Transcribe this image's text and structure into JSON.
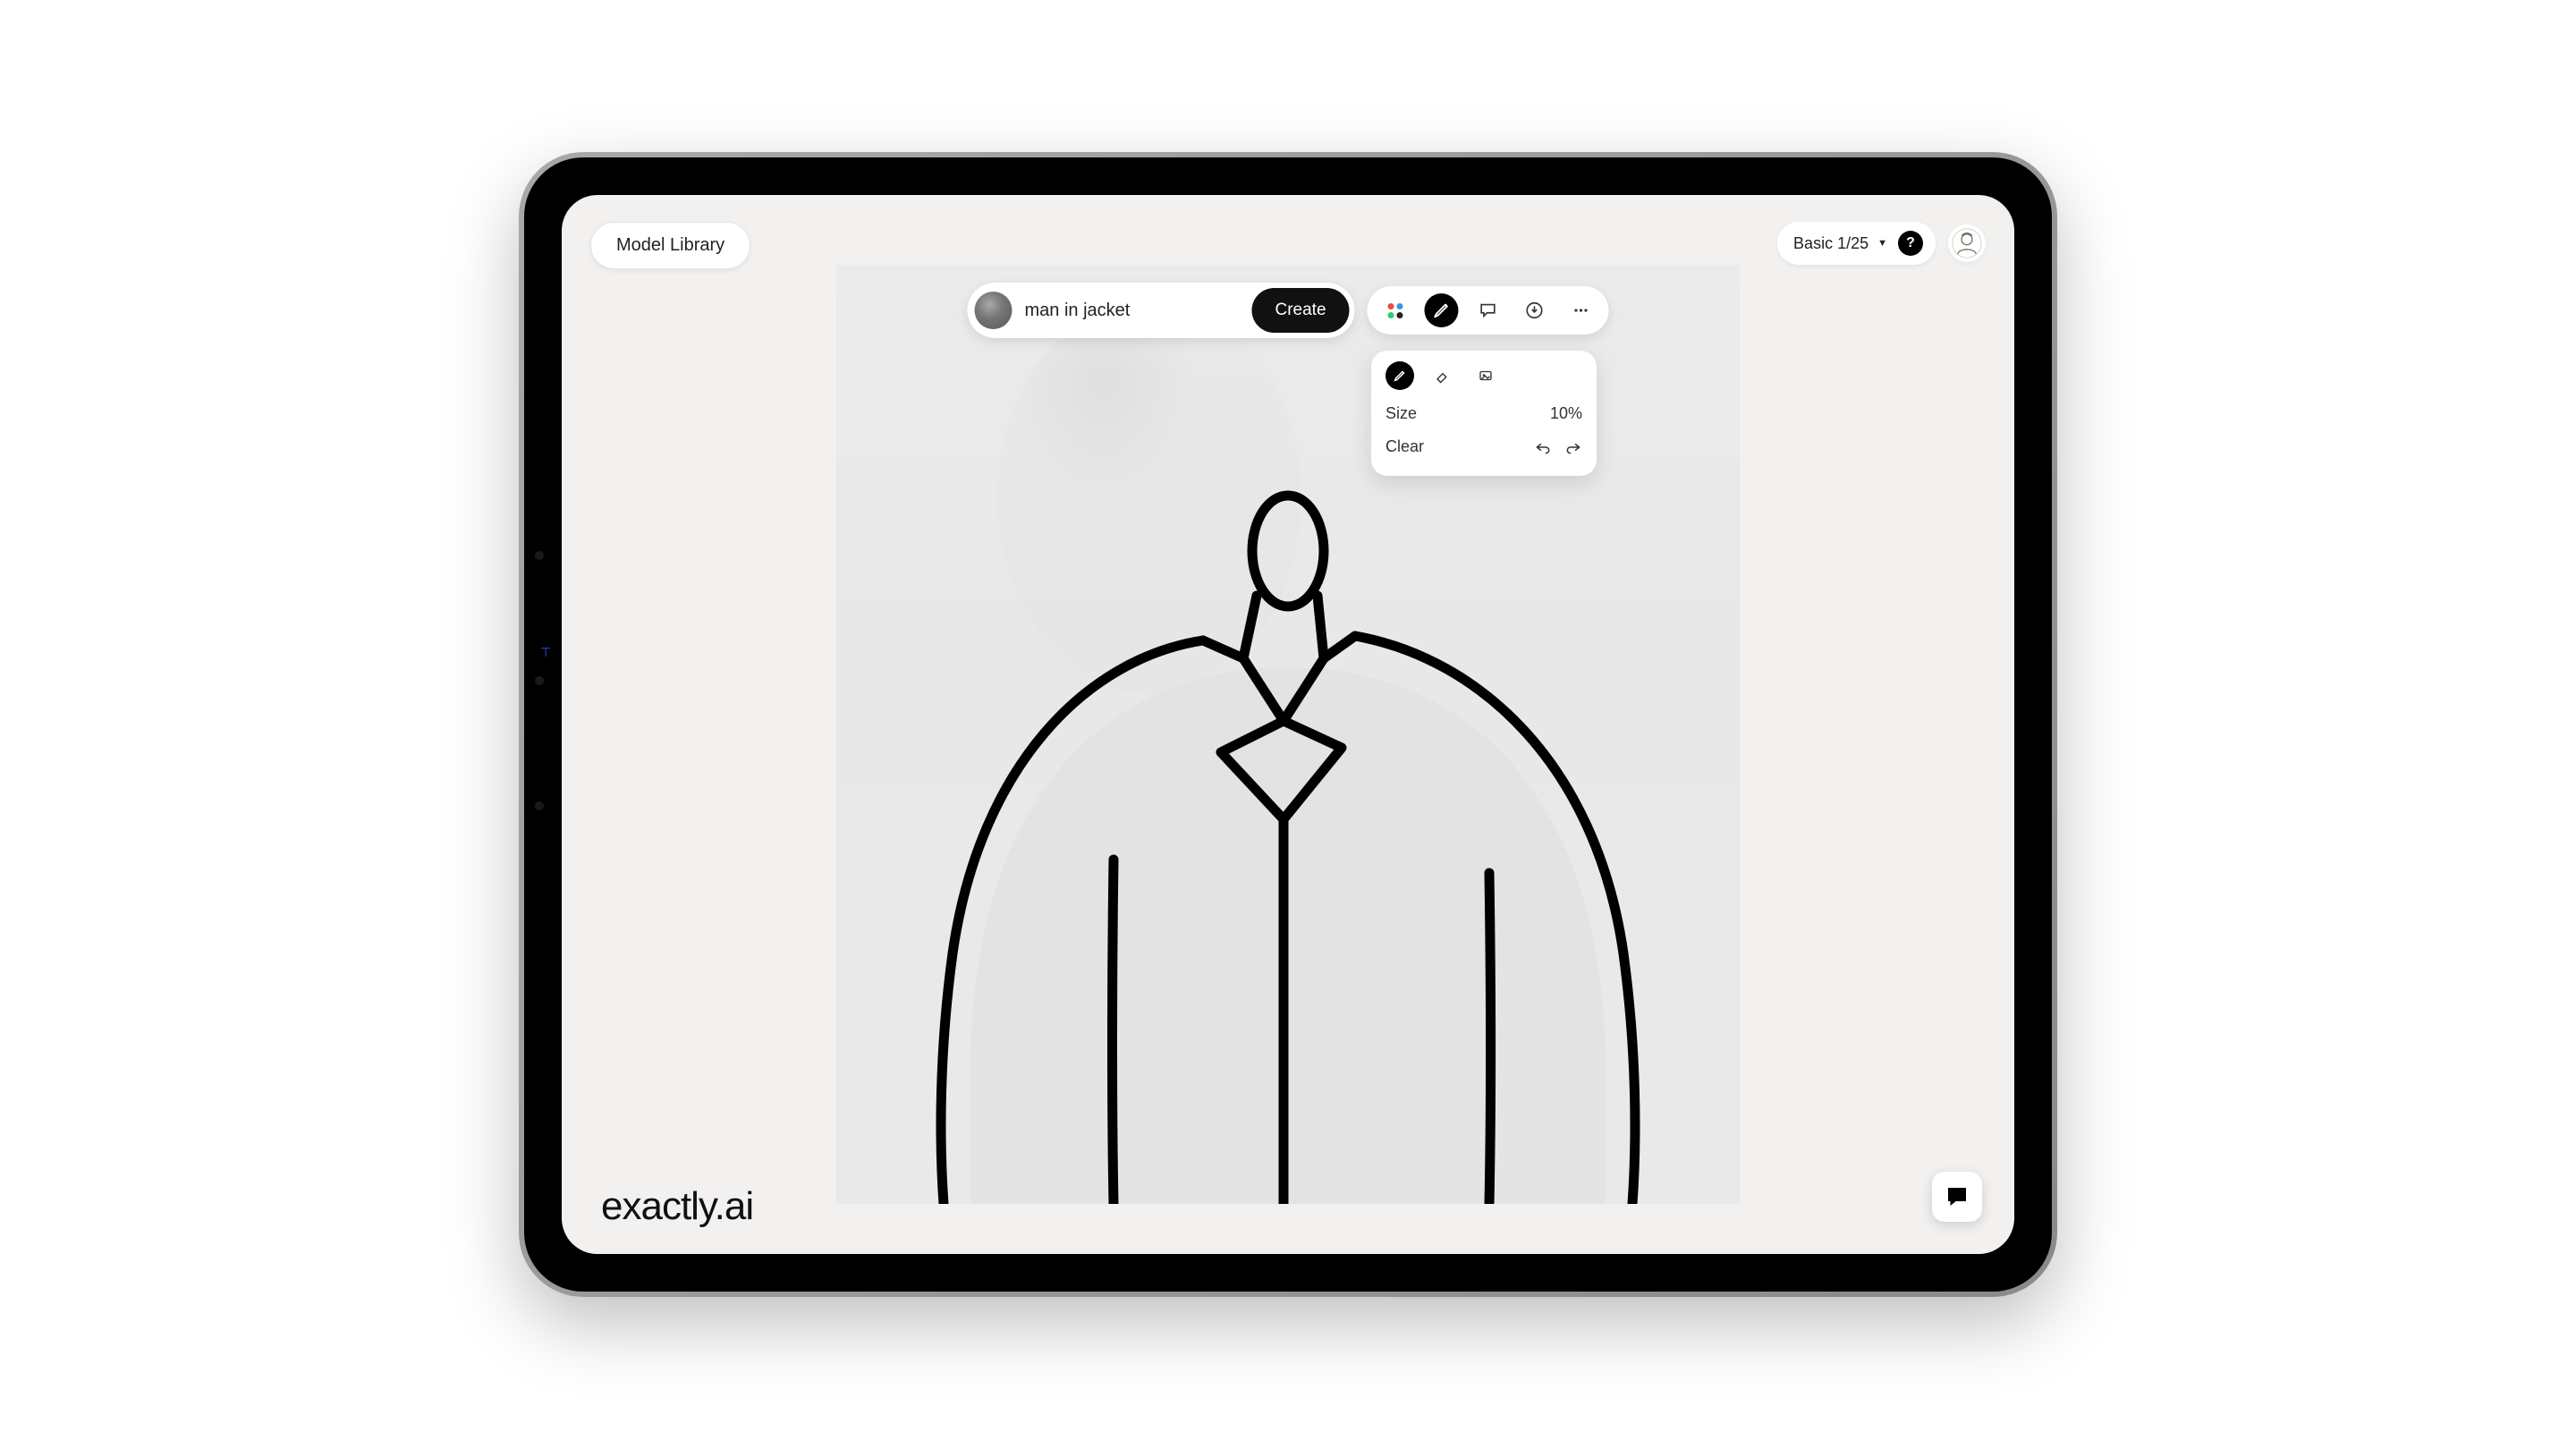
{
  "header": {
    "model_library_label": "Model Library",
    "plan_label": "Basic 1/25"
  },
  "prompt": {
    "value": "man in jacket",
    "create_label": "Create"
  },
  "draw_panel": {
    "size_label": "Size",
    "size_value": "10%",
    "clear_label": "Clear"
  },
  "brand": "exactly.ai"
}
